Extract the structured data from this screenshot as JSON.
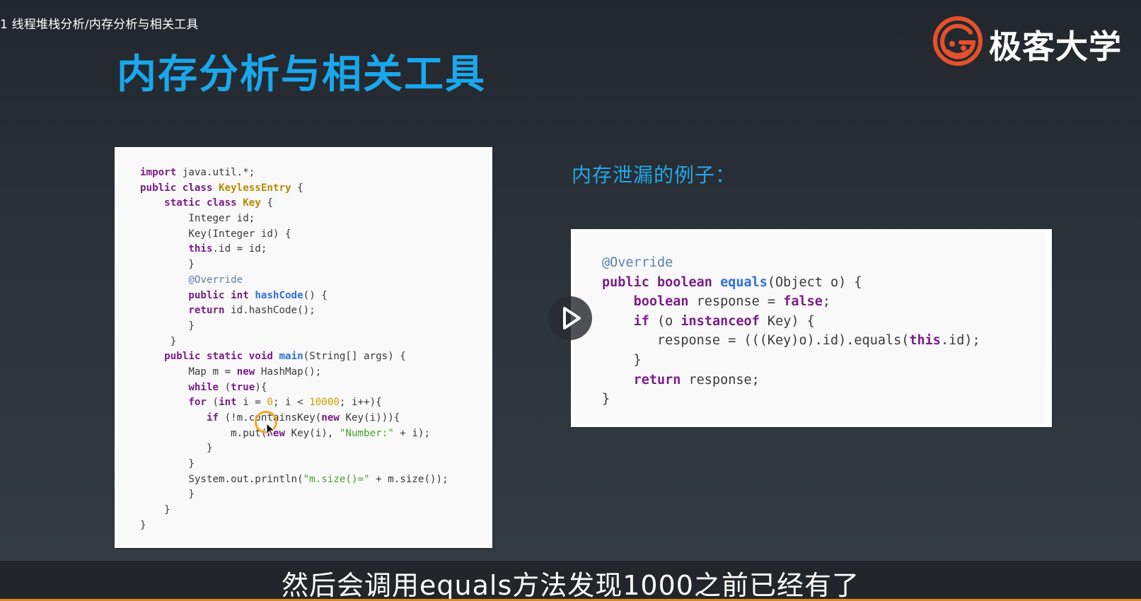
{
  "breadcrumb": "1 线程堆栈分析/内存分析与相关工具",
  "slide": {
    "title": "内存分析与相关工具",
    "subheading": "内存泄漏的例子："
  },
  "logo": {
    "text": "极客大学",
    "icon": "geek-university-logo-icon",
    "color": "#e4512b"
  },
  "code_left": [
    [
      [
        "kw",
        "import"
      ],
      [
        "plain",
        " java.util.*;"
      ]
    ],
    [
      [
        "kw",
        "public class "
      ],
      [
        "type",
        "KeylessEntry"
      ],
      [
        "plain",
        " {"
      ]
    ],
    [
      [
        "plain",
        "    "
      ],
      [
        "kw",
        "static class "
      ],
      [
        "type",
        "Key"
      ],
      [
        "plain",
        " {"
      ]
    ],
    [
      [
        "plain",
        "        Integer id;"
      ]
    ],
    [
      [
        "plain",
        "        Key(Integer id) {"
      ]
    ],
    [
      [
        "plain",
        "        "
      ],
      [
        "kw",
        "this"
      ],
      [
        "plain",
        ".id = id;"
      ]
    ],
    [
      [
        "plain",
        "        }"
      ]
    ],
    [
      [
        "plain",
        "        "
      ],
      [
        "ann",
        "@Override"
      ]
    ],
    [
      [
        "plain",
        "        "
      ],
      [
        "kw",
        "public int "
      ],
      [
        "fn",
        "hashCode"
      ],
      [
        "plain",
        "() {"
      ]
    ],
    [
      [
        "plain",
        "        "
      ],
      [
        "kw",
        "return"
      ],
      [
        "plain",
        " id.hashCode();"
      ]
    ],
    [
      [
        "plain",
        "        }"
      ]
    ],
    [
      [
        "plain",
        "     }"
      ]
    ],
    [
      [
        "plain",
        "    "
      ],
      [
        "kw",
        "public static void "
      ],
      [
        "fn",
        "main"
      ],
      [
        "plain",
        "(String[] args) {"
      ]
    ],
    [
      [
        "plain",
        "        Map m = "
      ],
      [
        "kw",
        "new"
      ],
      [
        "plain",
        " HashMap();"
      ]
    ],
    [
      [
        "plain",
        "        "
      ],
      [
        "kw",
        "while"
      ],
      [
        "plain",
        " ("
      ],
      [
        "kw",
        "true"
      ],
      [
        "plain",
        "){"
      ]
    ],
    [
      [
        "plain",
        "        "
      ],
      [
        "kw",
        "for"
      ],
      [
        "plain",
        " ("
      ],
      [
        "kw",
        "int"
      ],
      [
        "plain",
        " i = "
      ],
      [
        "num",
        "0"
      ],
      [
        "plain",
        "; i < "
      ],
      [
        "num",
        "10000"
      ],
      [
        "plain",
        "; i++){"
      ]
    ],
    [
      [
        "plain",
        "           "
      ],
      [
        "kw",
        "if"
      ],
      [
        "plain",
        " (!m.containsKey("
      ],
      [
        "kw",
        "new"
      ],
      [
        "plain",
        " Key(i))){"
      ]
    ],
    [
      [
        "plain",
        "               m.put("
      ],
      [
        "kw",
        "new"
      ],
      [
        "plain",
        " Key(i), "
      ],
      [
        "str",
        "\"Number:\""
      ],
      [
        "plain",
        " + i);"
      ]
    ],
    [
      [
        "plain",
        "           }"
      ]
    ],
    [
      [
        "plain",
        "        }"
      ]
    ],
    [
      [
        "plain",
        "        System.out.println("
      ],
      [
        "str",
        "\"m.size()=\""
      ],
      [
        "plain",
        " + m.size());"
      ]
    ],
    [
      [
        "plain",
        "        }"
      ]
    ],
    [
      [
        "plain",
        "    }"
      ]
    ],
    [
      [
        "plain",
        "}"
      ]
    ]
  ],
  "code_right": [
    [
      [
        "ann",
        "@Override"
      ]
    ],
    [
      [
        "kw",
        "public boolean "
      ],
      [
        "fn",
        "equals"
      ],
      [
        "plain",
        "(Object o) {"
      ]
    ],
    [
      [
        "plain",
        "    "
      ],
      [
        "kw",
        "boolean"
      ],
      [
        "plain",
        " response = "
      ],
      [
        "kw",
        "false"
      ],
      [
        "plain",
        ";"
      ]
    ],
    [
      [
        "plain",
        "    "
      ],
      [
        "kw",
        "if"
      ],
      [
        "plain",
        " (o "
      ],
      [
        "kw",
        "instanceof"
      ],
      [
        "plain",
        " Key) {"
      ]
    ],
    [
      [
        "plain",
        "       response = (((Key)o).id).equals("
      ],
      [
        "kw",
        "this"
      ],
      [
        "plain",
        ".id);"
      ]
    ],
    [
      [
        "plain",
        "    }"
      ]
    ],
    [
      [
        "plain",
        "    "
      ],
      [
        "kw",
        "return"
      ],
      [
        "plain",
        " response;"
      ]
    ],
    [
      [
        "plain",
        "}"
      ]
    ]
  ],
  "player": {
    "play_icon": "play-icon"
  },
  "subtitle": "然后会调用equals方法发现1000之前已经有了"
}
